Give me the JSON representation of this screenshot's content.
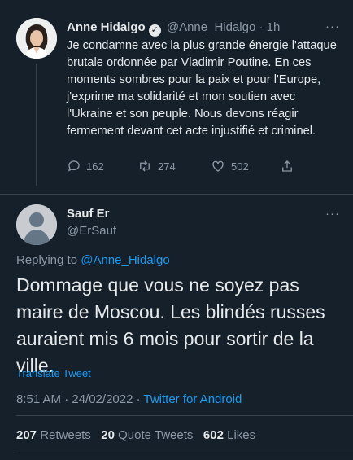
{
  "parent_tweet": {
    "author_name": "Anne Hidalgo",
    "verified_glyph": "✓",
    "handle": "@Anne_Hidalgo",
    "separator": "·",
    "time": "1h",
    "more": "···",
    "text": "Je condamne avec la plus grande énergie l'attaque brutale ordonnée par Vladimir Poutine. En ces moments sombres pour la paix et pour l'Europe, j'exprime ma solidarité et mon soutien avec l'Ukraine et son peuple. Nous devons réagir fermement devant cet acte injustifié et criminel.",
    "reply_count": "162",
    "retweet_count": "274",
    "like_count": "502"
  },
  "reply_tweet": {
    "author_name": "Sauf Er",
    "handle": "@ErSauf",
    "more": "···",
    "replying_prefix": "Replying to",
    "replying_to": "@Anne_Hidalgo",
    "text": "Dommage que vous ne soyez pas maire de Moscou. Les blindés russes auraient mis 6 mois pour sortir de la ville.",
    "translate_label": "Translate Tweet",
    "timestamp": "8:51 AM · 24/02/2022 · ",
    "source": "Twitter for Android",
    "retweets_count": "207",
    "retweets_label": "Retweets",
    "quotes_count": "20",
    "quotes_label": "Quote Tweets",
    "likes_count": "602",
    "likes_label": "Likes"
  },
  "colors": {
    "background": "#15202b",
    "text": "#e7e9ea",
    "secondary": "#8b98a5",
    "accent": "#1d9bf0",
    "divider": "#38444d"
  },
  "icons": [
    "reply-icon",
    "retweet-icon",
    "like-icon",
    "share-icon",
    "verified-badge-icon",
    "more-icon",
    "default-avatar-icon"
  ]
}
